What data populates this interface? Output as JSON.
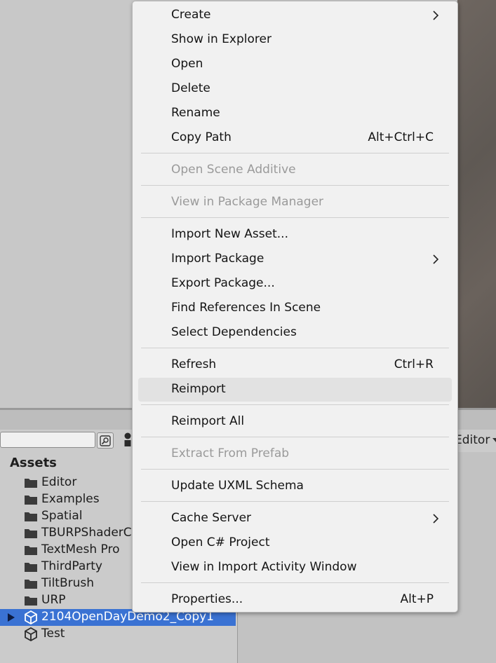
{
  "menu": {
    "items": [
      {
        "label": "Create",
        "submenu": true
      },
      {
        "label": "Show in Explorer"
      },
      {
        "label": "Open"
      },
      {
        "label": "Delete"
      },
      {
        "label": "Rename"
      },
      {
        "label": "Copy Path",
        "shortcut": "Alt+Ctrl+C"
      },
      {
        "label": "Open Scene Additive",
        "disabled": true
      },
      {
        "label": "View in Package Manager",
        "disabled": true
      },
      {
        "label": "Import New Asset..."
      },
      {
        "label": "Import Package",
        "submenu": true
      },
      {
        "label": "Export Package..."
      },
      {
        "label": "Find References In Scene"
      },
      {
        "label": "Select Dependencies"
      },
      {
        "label": "Refresh",
        "shortcut": "Ctrl+R"
      },
      {
        "label": "Reimport",
        "hovered": true
      },
      {
        "label": "Reimport All"
      },
      {
        "label": "Extract From Prefab",
        "disabled": true
      },
      {
        "label": "Update UXML Schema"
      },
      {
        "label": "Cache Server",
        "submenu": true
      },
      {
        "label": "Open C# Project"
      },
      {
        "label": "View in Import Activity Window"
      },
      {
        "label": "Properties...",
        "shortcut": "Alt+P"
      }
    ]
  },
  "project": {
    "header": "Assets",
    "folders": [
      "Editor",
      "Examples",
      "Spatial",
      "TBURPShaderC",
      "TextMesh Pro",
      "ThirdParty",
      "TiltBrush",
      "URP"
    ],
    "scenes": [
      {
        "label": "2104OpenDayDemo2_Copy1",
        "selected": true
      },
      {
        "label": "Test",
        "selected": false
      }
    ]
  },
  "toolbar": {
    "layout_dropdown": "Editor"
  },
  "colors": {
    "selection": "#3a72d3",
    "menu_bg": "#f1f1f1",
    "disabled_text": "#9a9a9a"
  }
}
